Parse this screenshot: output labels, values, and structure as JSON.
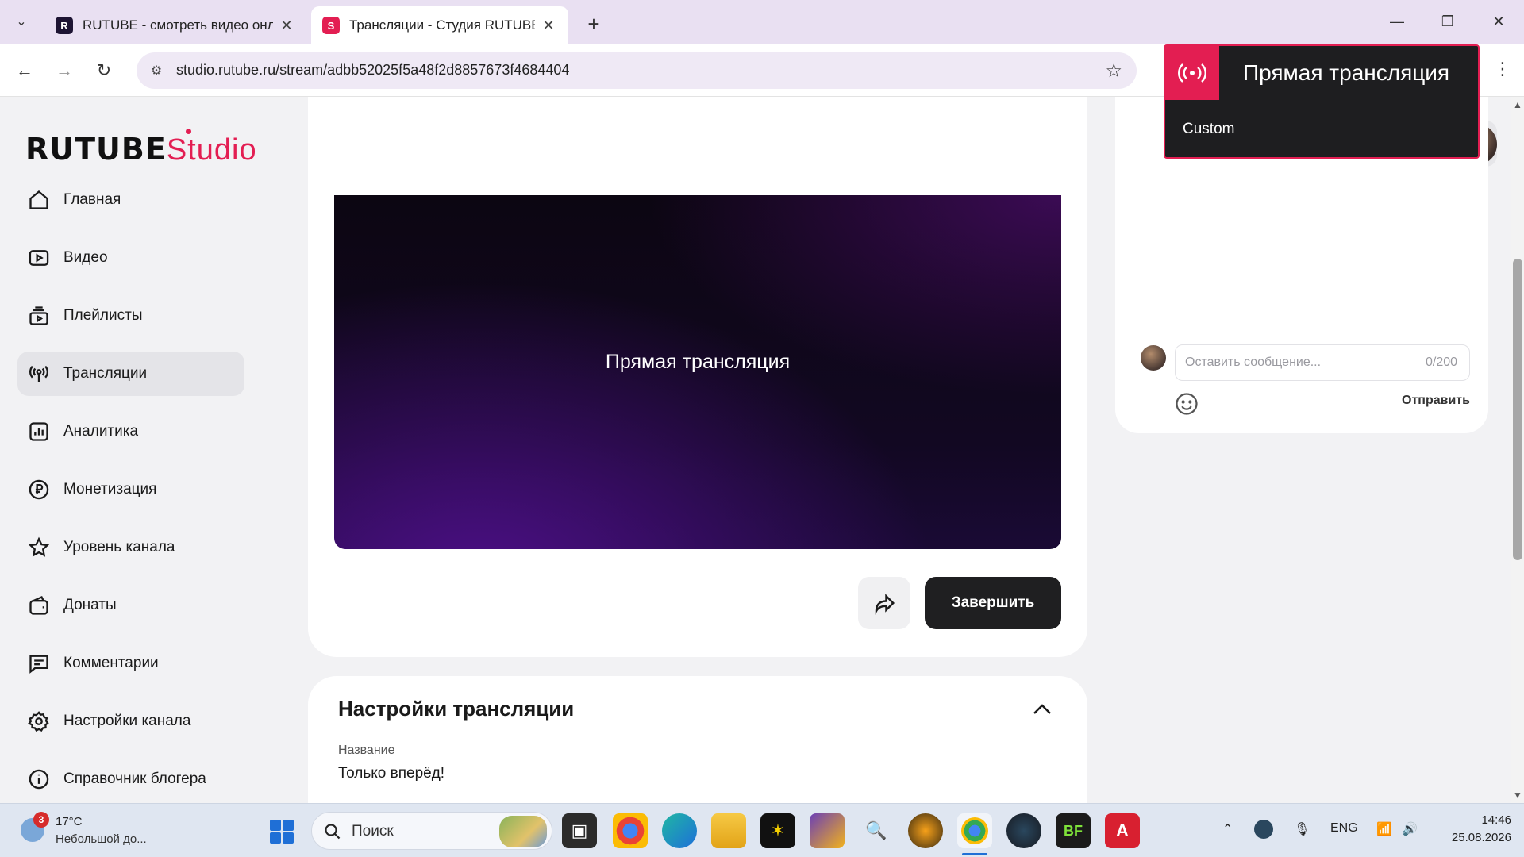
{
  "browser": {
    "tabs": [
      {
        "label": "RUTUBE - смотреть видео онлайн",
        "favicon": "R"
      },
      {
        "label": "Трансляции - Студия RUTUBE",
        "favicon": "S"
      }
    ],
    "url": "studio.rutube.ru/stream/adbb52025f5a48f2d8857673f4684404"
  },
  "logo": {
    "brand": "RUTUBE",
    "studio": "Studio"
  },
  "sidebar": {
    "items": [
      {
        "label": "Главная",
        "icon": "home-icon"
      },
      {
        "label": "Видео",
        "icon": "video-icon"
      },
      {
        "label": "Плейлисты",
        "icon": "playlist-icon"
      },
      {
        "label": "Трансляции",
        "icon": "broadcast-icon"
      },
      {
        "label": "Аналитика",
        "icon": "analytics-icon"
      },
      {
        "label": "Монетизация",
        "icon": "ruble-icon"
      },
      {
        "label": "Уровень канала",
        "icon": "star-icon"
      },
      {
        "label": "Донаты",
        "icon": "wallet-icon"
      },
      {
        "label": "Комментарии",
        "icon": "comment-icon"
      },
      {
        "label": "Настройки канала",
        "icon": "gear-icon"
      },
      {
        "label": "Справочник блогера",
        "icon": "info-icon"
      }
    ]
  },
  "player": {
    "title": "Прямая трансляция"
  },
  "actions": {
    "end_label": "Завершить"
  },
  "settings": {
    "title": "Настройки трансляции",
    "name_label": "Название",
    "name_value": "Только вперёд!"
  },
  "chat": {
    "placeholder": "Оставить сообщение...",
    "counter": "0/200",
    "send_label": "Отправить"
  },
  "popup": {
    "title": "Прямая трансляция",
    "subtitle": "Custom",
    "accent": "#e31e52"
  },
  "taskbar": {
    "weather_badge": "3",
    "temperature": "17°C",
    "weather": "Небольшой до...",
    "search_placeholder": "Поиск",
    "language": "ENG",
    "time": "14:46",
    "date": "25.08.2026"
  }
}
